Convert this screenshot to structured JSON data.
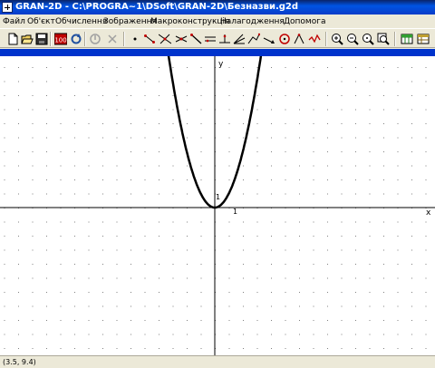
{
  "window": {
    "title": "GRAN-2D - C:\\PROGRA~1\\DSoft\\GRAN-2D\\Безназви.g2d"
  },
  "menu": {
    "items": [
      {
        "label": "Файл"
      },
      {
        "label": "Об'єкт"
      },
      {
        "label": "Обчислення"
      },
      {
        "label": "Зображення"
      },
      {
        "label": "Макроконструкція"
      },
      {
        "label": "Налагодження"
      },
      {
        "label": "Допомога"
      }
    ]
  },
  "toolbar": {
    "buttons": [
      {
        "icon": "new-file-icon"
      },
      {
        "icon": "open-folder-icon"
      },
      {
        "icon": "save-disk-icon"
      },
      {
        "icon": "numeric-100-icon"
      },
      {
        "icon": "refresh-icon"
      },
      {
        "icon": "disabled-circle-icon"
      },
      {
        "icon": "disabled-cross-icon"
      },
      {
        "icon": "point-icon"
      },
      {
        "icon": "segment-points-icon"
      },
      {
        "icon": "line-points-icon"
      },
      {
        "icon": "intersection-icon"
      },
      {
        "icon": "ray-icon"
      },
      {
        "icon": "parallel-lines-icon"
      },
      {
        "icon": "perpendicular-icon"
      },
      {
        "icon": "angle-bisector-icon"
      },
      {
        "icon": "polyline-icon"
      },
      {
        "icon": "vector-icon"
      },
      {
        "icon": "circle-icon"
      },
      {
        "icon": "triangle-icon"
      },
      {
        "icon": "broken-line-icon"
      },
      {
        "icon": "zoom-in-icon"
      },
      {
        "icon": "zoom-out-icon"
      },
      {
        "icon": "zoom-reset-icon"
      },
      {
        "icon": "zoom-window-icon"
      },
      {
        "icon": "table-icon"
      },
      {
        "icon": "table-settings-icon"
      }
    ]
  },
  "graph": {
    "x_axis_label": "x",
    "y_axis_label": "y",
    "x_unit_label": "1",
    "y_unit_label": "1",
    "function": "y = x^2",
    "curve_color": "#000000",
    "axis_color": "#000000",
    "grid_color": "#808080"
  },
  "status": {
    "coordinates": "(3.5, 9.4)"
  }
}
